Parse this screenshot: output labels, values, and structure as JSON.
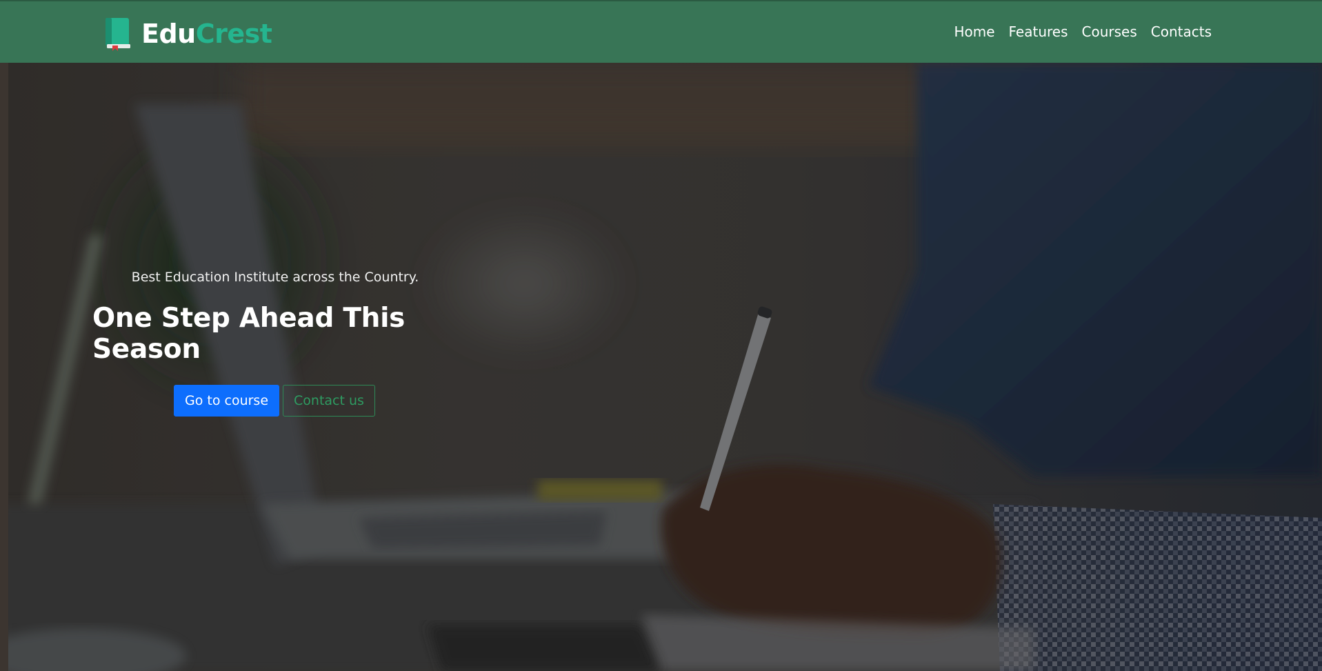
{
  "brand": {
    "name_part1": "Edu",
    "name_part2": "Crest",
    "logo_icon": "book-icon",
    "colors": {
      "part1": "#ffffff",
      "part2": "#25b58f",
      "navbar_bg": "#387556"
    }
  },
  "nav": {
    "items": [
      {
        "label": "Home"
      },
      {
        "label": "Features"
      },
      {
        "label": "Courses"
      },
      {
        "label": "Contacts"
      }
    ]
  },
  "hero": {
    "tagline": "Best Education Institute across the Country.",
    "title": "One Step Ahead This Season",
    "primary_button": "Go to course",
    "secondary_button": "Contact us",
    "colors": {
      "primary_button": "#0d6efd",
      "secondary_button": "#2e9c62"
    }
  }
}
